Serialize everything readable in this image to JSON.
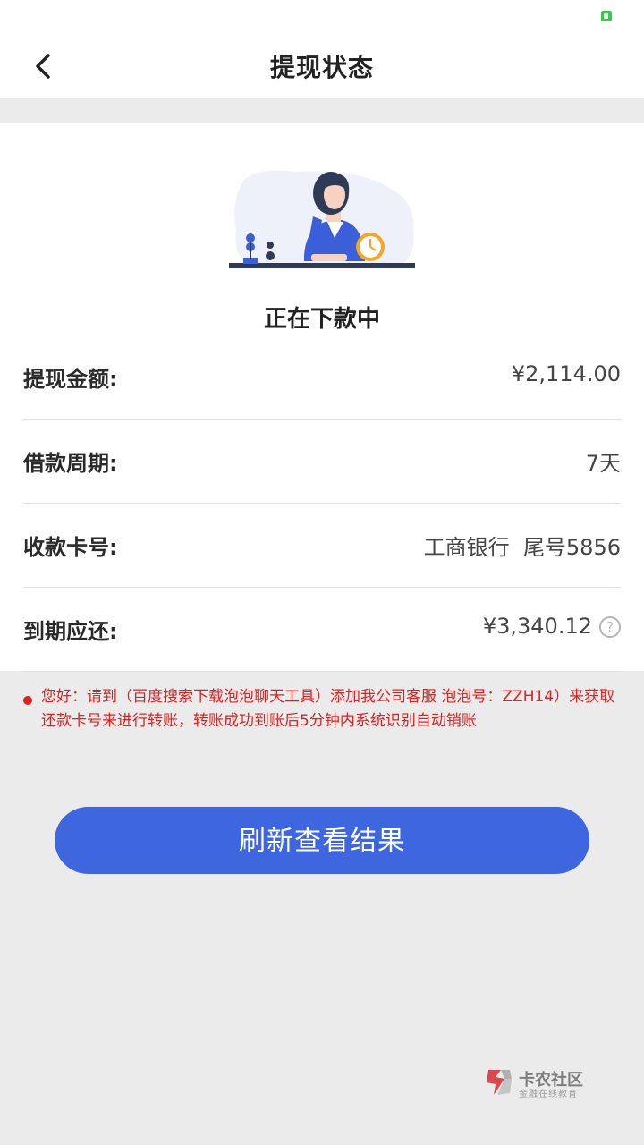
{
  "header": {
    "title": "提现状态"
  },
  "status": {
    "text": "正在下款中"
  },
  "details": [
    {
      "label": "提现金额:",
      "value": "¥2,114.00"
    },
    {
      "label": "借款周期:",
      "value": "7天"
    },
    {
      "label": "收款卡号:",
      "value": "工商银行  尾号5856"
    },
    {
      "label": "到期应还:",
      "value": "¥3,340.12",
      "help": "?"
    }
  ],
  "notice": {
    "text": "您好：请到（百度搜索下载泡泡聊天工具）添加我公司客服 泡泡号：ZZH14）来获取还款卡号来进行转账，转账成功到账后5分钟内系统识别自动销账"
  },
  "actions": {
    "refresh_label": "刷新查看结果"
  },
  "watermark": {
    "name": "卡农社区",
    "tagline": "金融在线教育"
  },
  "colors": {
    "accent": "#3d66df",
    "warning": "#e02020",
    "clock": "#f5a623",
    "figure": "#3a5fd9"
  },
  "icons": {
    "back": "chevron-left-icon",
    "help": "question-circle-icon"
  }
}
